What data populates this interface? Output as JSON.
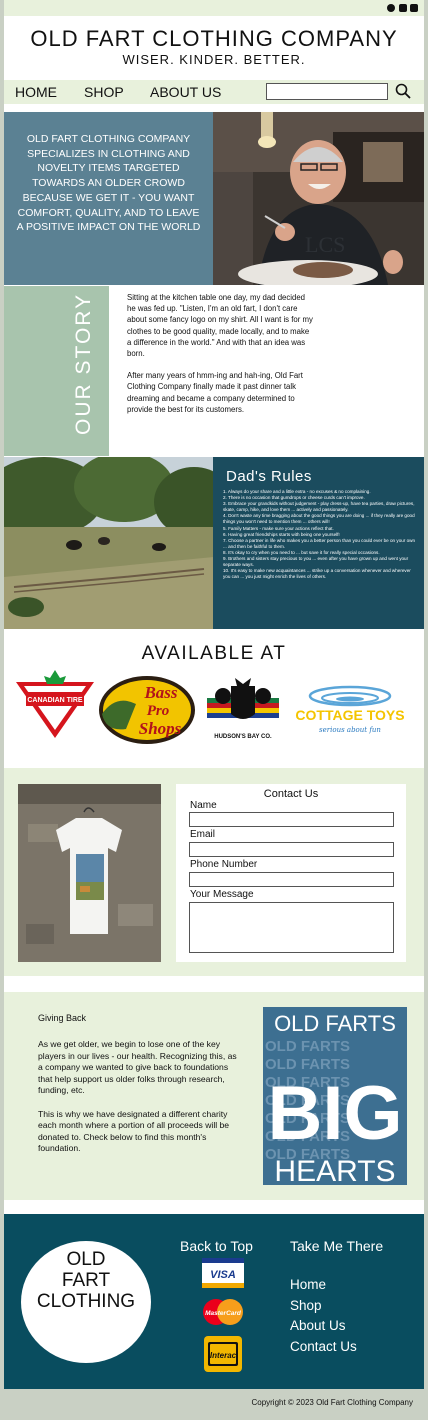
{
  "social": {
    "icons": [
      "facebook-icon",
      "instagram-icon",
      "tiktok-icon"
    ]
  },
  "header": {
    "brand": "OLD FART CLOTHING COMPANY",
    "tagline": "WISER. KINDER. BETTER."
  },
  "nav": {
    "items": [
      "HOME",
      "SHOP",
      "ABOUT US"
    ],
    "search_value": ""
  },
  "hero": {
    "text": "OLD FART CLOTHING COMPANY SPECIALIZES IN CLOTHING AND NOVELTY ITEMS TARGETED TOWARDS AN OLDER CROWD BECAUSE WE GET IT - YOU WANT COMFORT, QUALITY, AND TO LEAVE A POSITIVE IMPACT ON THE WORLD"
  },
  "story": {
    "title": "OUR STORY",
    "paragraphs": [
      "Sitting at the kitchen table one day, my dad decided he was fed up.  \"Listen, I'm an old fart, I don't care about some fancy logo on my shirt.  All I want is for my clothes to be good quality, made locally, and to make a difference in the world.\"  And with that an idea was born.",
      "After many years of hmm-ing and hah-ing, Old Fart Clothing Company finally made it past dinner talk dreaming and became a company determined to provide the best for its customers."
    ]
  },
  "rules": {
    "title": "Dad's Rules",
    "items": [
      "1. Always do your share and a little extra - no excuses & no complaining.",
      "2. There is no occasion that gumdrops or cheese curds can't improve.",
      "3. Embrace your grandkids without judgement - play dress-up, have tea parties, draw pictures, skate, camp, hike, and love them ... actively and passionately.",
      "4. Don't waste any time bragging about the good things you are doing ... if they really are good things you won't need to mention them ... others will!",
      "5. Family Matters - make sure your actions reflect that.",
      "6. Having great friendships starts with being one yourself!",
      "7. Choose a partner in life who makes you a better person than you could ever be on your own ... and then be faithful to them.",
      "8. It's okay to cry when you need to ... but save it for really special occasions.",
      "9. Brothers and sisters stay precious to you ... even after you have grown up and went your separate ways.",
      "10. It's easy to make new acquaintances ... strike up a conversation whenever and wherever you can ... you just might enrich the lives of others."
    ]
  },
  "available": {
    "title": "AVAILABLE AT",
    "stores": {
      "canadian_tire": "CANADIAN TIRE",
      "bass_pro_1": "Bass",
      "bass_pro_2": "Pro",
      "bass_pro_3": "Shops",
      "hudsons_bay": "HUDSON'S BAY CO.",
      "cottage_toys": "COTTAGE TOYS",
      "cottage_toys_tag": "serious about fun"
    }
  },
  "contact": {
    "title": "Contact Us",
    "fields": [
      "Name",
      "Email",
      "Phone Number",
      "Your Message"
    ]
  },
  "giving": {
    "title": "Giving Back",
    "paragraphs": [
      "As we get older, we begin to lose one of the key players in our lives - our health.  Recognizing this, as a company we wanted to give back to foundations that help support us older folks through research, funding, etc.",
      "This is why we have designated a different charity each month where a portion of all proceeds will be donated to.  Check below to find this month's foundation."
    ],
    "poster": {
      "line1": "OLD FARTS",
      "big": "BIG",
      "line_bottom": "HEARTS",
      "bg_repeat": "OLD FARTS"
    }
  },
  "footer": {
    "logo_lines": [
      "OLD",
      "FART",
      "CLOTHING"
    ],
    "back_to_top": "Back to Top",
    "take_me_there": "Take Me There",
    "links": [
      "Home",
      "Shop",
      "About Us",
      "Contact Us"
    ],
    "payments": {
      "visa": "VISA",
      "mastercard": "MasterCard",
      "interac": "Interac"
    },
    "copyright": "Copyright © 2023 Old Fart Clothing Company"
  },
  "colors": {
    "pale_green": "#e8f1dc",
    "slate_blue": "#5b8193",
    "sage": "#a8c4ad",
    "dark_teal": "#1b4c5e",
    "footer_teal": "#094d5f"
  }
}
